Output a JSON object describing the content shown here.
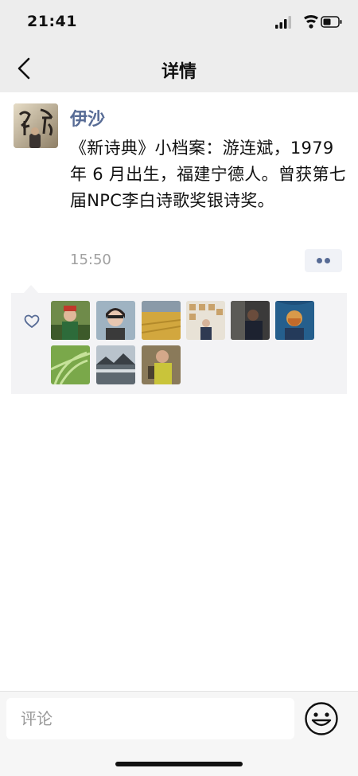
{
  "status_bar": {
    "time": "21:41"
  },
  "nav": {
    "title": "详情",
    "back_icon": "chevron-left-icon"
  },
  "post": {
    "author": "伊沙",
    "text": "《新诗典》小档案：游连斌，1979 年 6 月出生，福建宁德人。曾获第七届NPC李白诗歌奖银诗奖。",
    "time": "15:50",
    "more_icon": "ellipsis-icon"
  },
  "likes": {
    "icon": "heart-icon",
    "avatars": [
      "avatar-1",
      "avatar-2",
      "avatar-3",
      "avatar-4",
      "avatar-5",
      "avatar-6",
      "avatar-7",
      "avatar-8",
      "avatar-9"
    ]
  },
  "comment_bar": {
    "placeholder": "评论",
    "emoji_icon": "emoji-icon"
  },
  "colors": {
    "nav_bg": "#ededed",
    "link": "#576b95",
    "time_gray": "#a0a0a0",
    "panel_bg": "#f3f3f5"
  }
}
